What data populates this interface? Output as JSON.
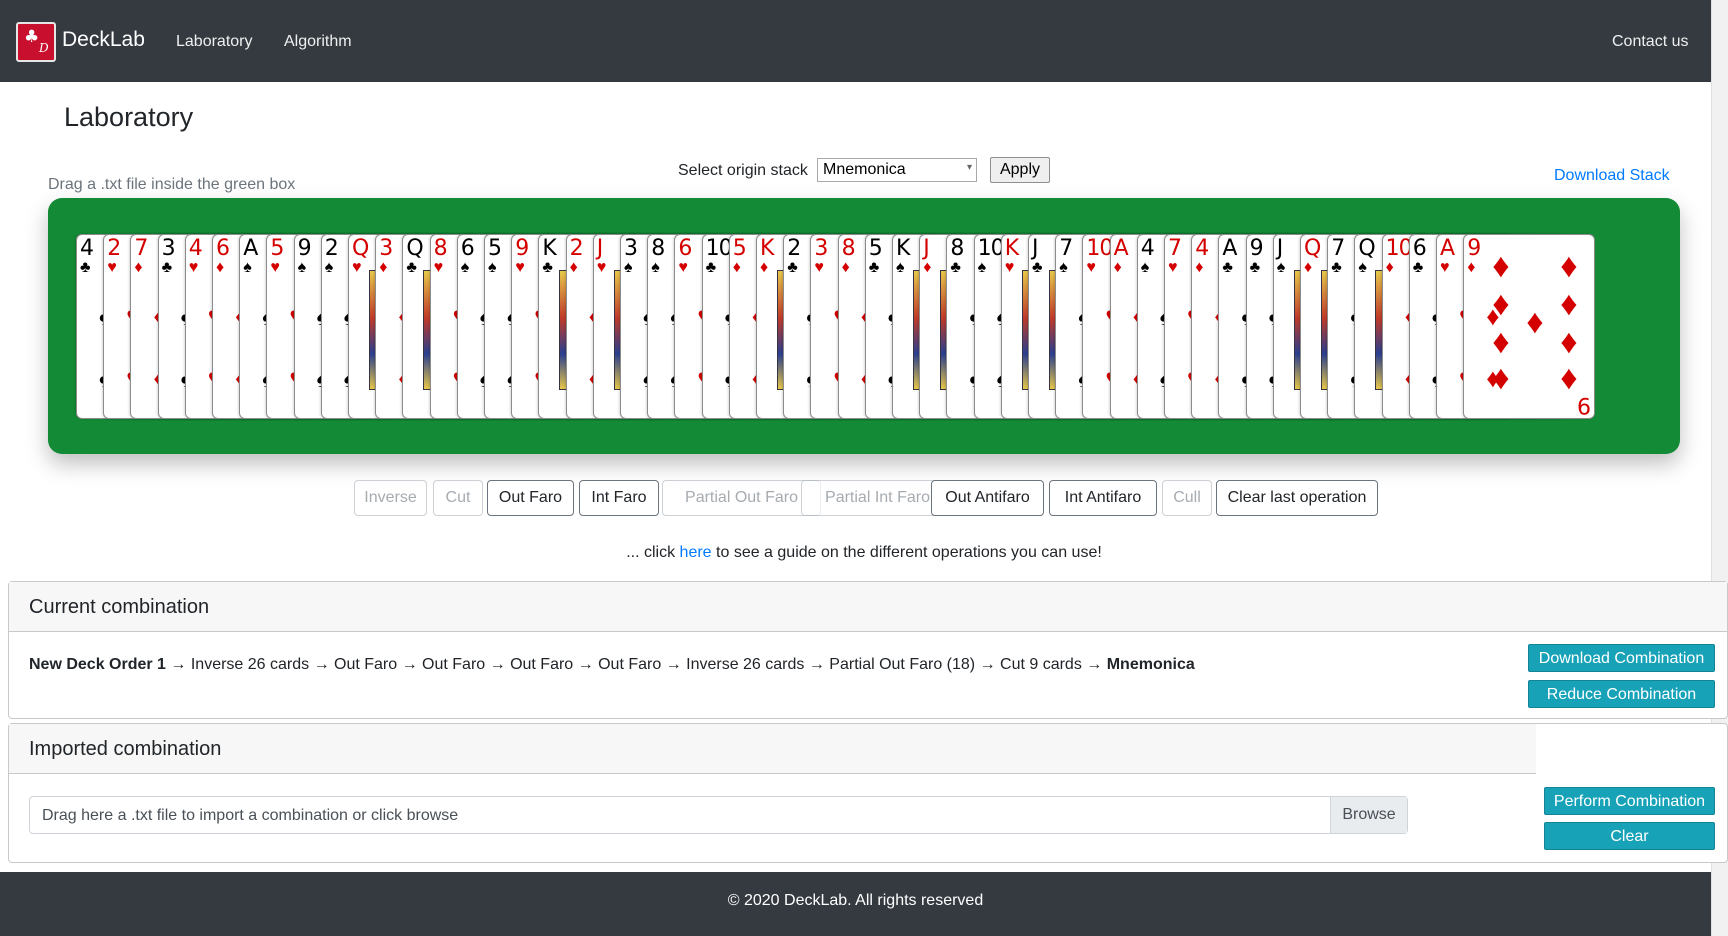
{
  "brand": {
    "name": "DeckLab",
    "logo_club": "♣",
    "logo_letter": "D"
  },
  "nav": {
    "items": [
      "Laboratory",
      "Algorithm"
    ],
    "contact": "Contact us"
  },
  "page_title": "Laboratory",
  "drag_hint": "Drag a .txt file inside the green box",
  "origin": {
    "label": "Select origin stack",
    "selected": "Mnemonica",
    "apply": "Apply"
  },
  "download_stack": "Download Stack",
  "cards": [
    {
      "rank": "4",
      "suit": "♣",
      "color": "black"
    },
    {
      "rank": "2",
      "suit": "♥",
      "color": "red"
    },
    {
      "rank": "7",
      "suit": "♦",
      "color": "red"
    },
    {
      "rank": "3",
      "suit": "♣",
      "color": "black"
    },
    {
      "rank": "4",
      "suit": "♥",
      "color": "red"
    },
    {
      "rank": "6",
      "suit": "♦",
      "color": "red"
    },
    {
      "rank": "A",
      "suit": "♠",
      "color": "black"
    },
    {
      "rank": "5",
      "suit": "♥",
      "color": "red"
    },
    {
      "rank": "9",
      "suit": "♠",
      "color": "black"
    },
    {
      "rank": "2",
      "suit": "♠",
      "color": "black"
    },
    {
      "rank": "Q",
      "suit": "♥",
      "color": "red"
    },
    {
      "rank": "3",
      "suit": "♦",
      "color": "red"
    },
    {
      "rank": "Q",
      "suit": "♣",
      "color": "black"
    },
    {
      "rank": "8",
      "suit": "♥",
      "color": "red"
    },
    {
      "rank": "6",
      "suit": "♠",
      "color": "black"
    },
    {
      "rank": "5",
      "suit": "♠",
      "color": "black"
    },
    {
      "rank": "9",
      "suit": "♥",
      "color": "red"
    },
    {
      "rank": "K",
      "suit": "♣",
      "color": "black"
    },
    {
      "rank": "2",
      "suit": "♦",
      "color": "red"
    },
    {
      "rank": "J",
      "suit": "♥",
      "color": "red"
    },
    {
      "rank": "3",
      "suit": "♠",
      "color": "black"
    },
    {
      "rank": "8",
      "suit": "♠",
      "color": "black"
    },
    {
      "rank": "6",
      "suit": "♥",
      "color": "red"
    },
    {
      "rank": "10",
      "suit": "♣",
      "color": "black"
    },
    {
      "rank": "5",
      "suit": "♦",
      "color": "red"
    },
    {
      "rank": "K",
      "suit": "♦",
      "color": "red"
    },
    {
      "rank": "2",
      "suit": "♣",
      "color": "black"
    },
    {
      "rank": "3",
      "suit": "♥",
      "color": "red"
    },
    {
      "rank": "8",
      "suit": "♦",
      "color": "red"
    },
    {
      "rank": "5",
      "suit": "♣",
      "color": "black"
    },
    {
      "rank": "K",
      "suit": "♠",
      "color": "black"
    },
    {
      "rank": "J",
      "suit": "♦",
      "color": "red"
    },
    {
      "rank": "8",
      "suit": "♣",
      "color": "black"
    },
    {
      "rank": "10",
      "suit": "♠",
      "color": "black"
    },
    {
      "rank": "K",
      "suit": "♥",
      "color": "red"
    },
    {
      "rank": "J",
      "suit": "♣",
      "color": "black"
    },
    {
      "rank": "7",
      "suit": "♠",
      "color": "black"
    },
    {
      "rank": "10",
      "suit": "♥",
      "color": "red"
    },
    {
      "rank": "A",
      "suit": "♦",
      "color": "red"
    },
    {
      "rank": "4",
      "suit": "♠",
      "color": "black"
    },
    {
      "rank": "7",
      "suit": "♥",
      "color": "red"
    },
    {
      "rank": "4",
      "suit": "♦",
      "color": "red"
    },
    {
      "rank": "A",
      "suit": "♣",
      "color": "black"
    },
    {
      "rank": "9",
      "suit": "♣",
      "color": "black"
    },
    {
      "rank": "J",
      "suit": "♠",
      "color": "black"
    },
    {
      "rank": "Q",
      "suit": "♦",
      "color": "red"
    },
    {
      "rank": "7",
      "suit": "♣",
      "color": "black"
    },
    {
      "rank": "Q",
      "suit": "♠",
      "color": "black"
    },
    {
      "rank": "10",
      "suit": "♦",
      "color": "red"
    },
    {
      "rank": "6",
      "suit": "♣",
      "color": "black"
    },
    {
      "rank": "A",
      "suit": "♥",
      "color": "red"
    },
    {
      "rank": "9",
      "suit": "♦",
      "color": "red"
    }
  ],
  "operations": [
    {
      "label": "Inverse",
      "enabled": false
    },
    {
      "label": "Cut",
      "enabled": false
    },
    {
      "label": "Out Faro",
      "enabled": true
    },
    {
      "label": "Int Faro",
      "enabled": true
    },
    {
      "label": "Partial Out Faro",
      "enabled": false
    },
    {
      "label": "Partial Int Faro",
      "enabled": false
    },
    {
      "label": "Out Antifaro",
      "enabled": true
    },
    {
      "label": "Int Antifaro",
      "enabled": true
    },
    {
      "label": "Cull",
      "enabled": false
    },
    {
      "label": "Clear last operation",
      "enabled": true
    }
  ],
  "guide": {
    "prefix": "... click ",
    "link": "here",
    "suffix": " to see a guide on the different operations you can use!"
  },
  "current": {
    "title": "Current combination",
    "start": "New Deck Order 1",
    "steps": "→ Inverse 26 cards → Out Faro → Out Faro → Out Faro → Out Faro → Inverse 26 cards → Partial Out Faro (18) → Cut 9 cards →",
    "end": "Mnemonica",
    "download": "Download Combination",
    "reduce": "Reduce Combination"
  },
  "imported": {
    "title": "Imported combination",
    "placeholder": "Drag here a .txt file to import a combination or click browse",
    "browse": "Browse",
    "perform": "Perform Combination",
    "clear": "Clear"
  },
  "footer": "© 2020 DeckLab. All rights reserved",
  "colors": {
    "navbar": "#343a40",
    "green": "#138a36",
    "cyan": "#17a2b8",
    "link": "#007bff",
    "red_suit": "#d40000"
  }
}
